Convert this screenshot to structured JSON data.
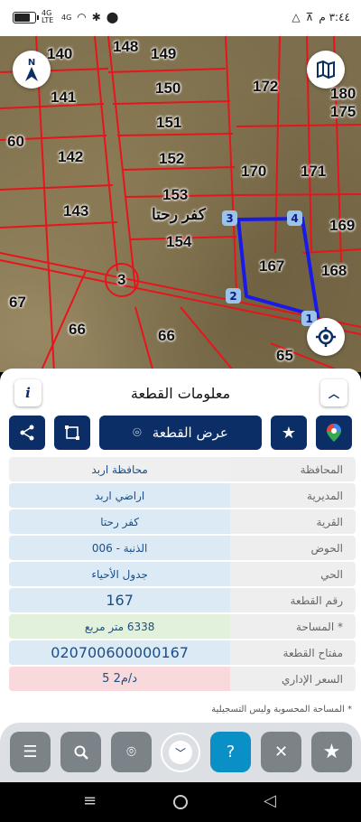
{
  "status_bar": {
    "time": "٣:٤٤ م",
    "network": "4G LTE",
    "signal_2": "4G"
  },
  "map": {
    "plots": [
      "140",
      "148",
      "149",
      "141",
      "150",
      "172",
      "180",
      "175",
      "60",
      "142",
      "151",
      "152",
      "170",
      "171",
      "143",
      "153",
      "154",
      "169",
      "167",
      "168",
      "3",
      "67",
      "66",
      "66",
      "65"
    ],
    "village_label": "كفر رحتا",
    "vertices": [
      "1",
      "2",
      "3",
      "4"
    ],
    "compass_letter": "N"
  },
  "panel": {
    "title": "معلومات القطعة",
    "info_button": "i",
    "show_plot_label": "عرض القطعة",
    "rows": [
      {
        "label": "المحافظة",
        "value": "محافظة اربد",
        "tone": "gray"
      },
      {
        "label": "المديرية",
        "value": "اراضي اربد",
        "tone": "blue"
      },
      {
        "label": "القرية",
        "value": "كفر رحتا",
        "tone": "blue"
      },
      {
        "label": "الحوض",
        "value": "الذنبة - 006",
        "tone": "blue"
      },
      {
        "label": "الحي",
        "value": "جدول الأحياء",
        "tone": "blue"
      },
      {
        "label": "رقم القطعة",
        "value": "167",
        "tone": "blue"
      },
      {
        "label": "المساحة *",
        "value": "6338 متر مربع",
        "tone": "green"
      },
      {
        "label": "مفتاح القطعة",
        "value": "020700600000167",
        "tone": "blue"
      },
      {
        "label": "السعر الإداري",
        "value": "5 د/م2",
        "tone": "pink"
      }
    ],
    "footnote": "* المساحة المحسوبة وليس التسجيلية"
  },
  "colors": {
    "primary": "#0b2e66",
    "parcel_line": "#e8141c",
    "selection": "#1a1ae6",
    "active_tab": "#0b8fc7"
  }
}
